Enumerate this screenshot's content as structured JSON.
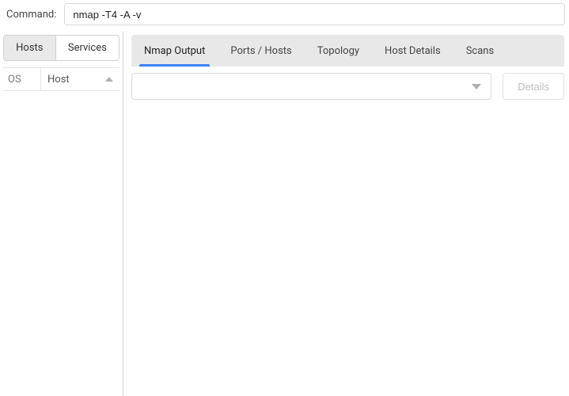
{
  "command": {
    "label": "Command:",
    "value": "nmap -T4 -A -v"
  },
  "left_panel": {
    "tabs": [
      {
        "label": "Hosts",
        "active": true
      },
      {
        "label": "Services",
        "active": false
      }
    ],
    "columns": {
      "os": "OS",
      "host": "Host"
    }
  },
  "main_tabs": [
    {
      "label": "Nmap Output",
      "active": true
    },
    {
      "label": "Ports / Hosts",
      "active": false
    },
    {
      "label": "Topology",
      "active": false
    },
    {
      "label": "Host Details",
      "active": false
    },
    {
      "label": "Scans",
      "active": false
    }
  ],
  "output_toolbar": {
    "dropdown_selected": "",
    "details_label": "Details"
  }
}
